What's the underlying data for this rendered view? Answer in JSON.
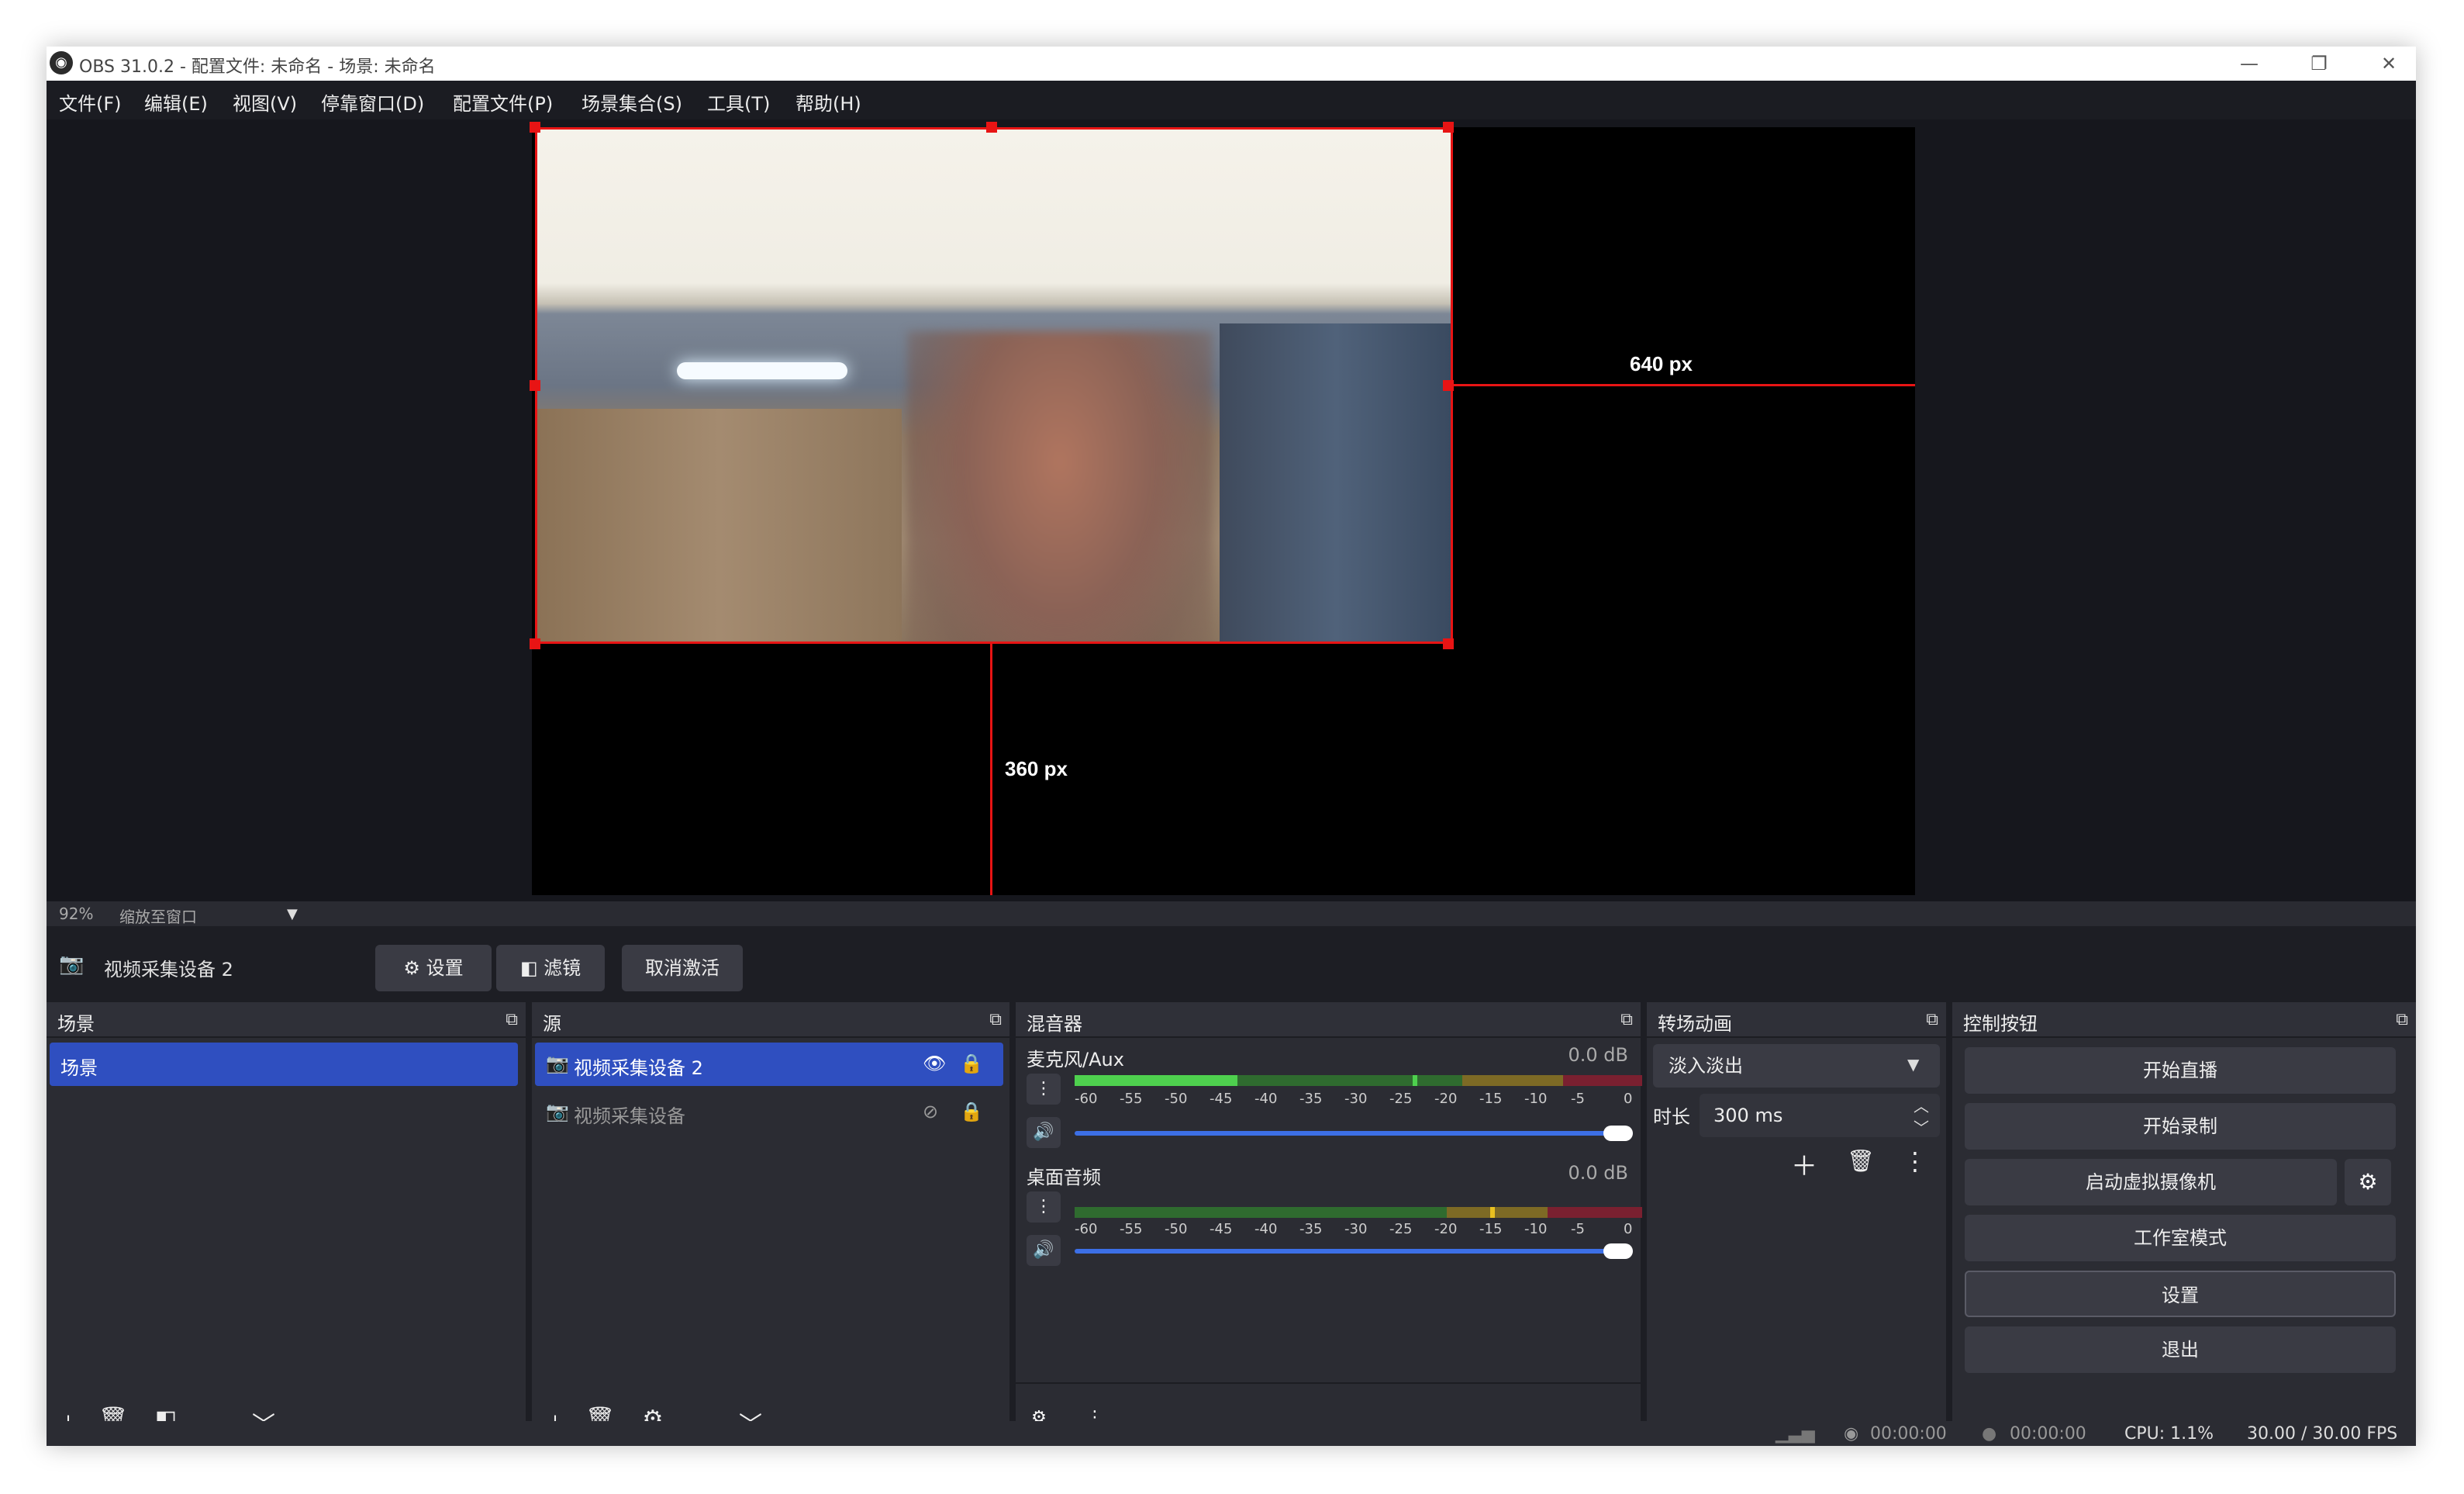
{
  "window": {
    "title": "OBS 31.0.2 - 配置文件: 未命名 - 场景: 未命名",
    "minimize": "—",
    "maximize": "❐",
    "close": "✕"
  },
  "menu": [
    "文件(F)",
    "编辑(E)",
    "视图(V)",
    "停靠窗口(D)",
    "配置文件(P)",
    "场景集合(S)",
    "工具(T)",
    "帮助(H)"
  ],
  "preview": {
    "width_label": "640 px",
    "height_label": "360 px",
    "zoom_value": "92%",
    "zoom_mode": "缩放至窗口",
    "accent": "#e81414"
  },
  "source_toolbar": {
    "source_name": "视频采集设备 2",
    "settings": "设置",
    "filters": "滤镜",
    "deactivate": "取消激活"
  },
  "scenes": {
    "title": "场景",
    "items": [
      "场景"
    ]
  },
  "sources": {
    "title": "源",
    "items": [
      {
        "name": "视频采集设备 2",
        "visible": true,
        "selected": true
      },
      {
        "name": "视频采集设备",
        "visible": false,
        "selected": false
      }
    ]
  },
  "mixer": {
    "title": "混音器",
    "channels": [
      {
        "name": "麦克风/Aux",
        "db": "0.0 dB"
      },
      {
        "name": "桌面音频",
        "db": "0.0 dB"
      }
    ],
    "scale": [
      "-60",
      "-55",
      "-50",
      "-45",
      "-40",
      "-35",
      "-30",
      "-25",
      "-20",
      "-15",
      "-10",
      "-5",
      "0"
    ]
  },
  "transitions": {
    "title": "转场动画",
    "selected": "淡入淡出",
    "duration_label": "时长",
    "duration_value": "300 ms"
  },
  "controls": {
    "title": "控制按钮",
    "start_stream": "开始直播",
    "start_record": "开始录制",
    "virtual_cam": "启动虚拟摄像机",
    "studio_mode": "工作室模式",
    "settings": "设置",
    "exit": "退出"
  },
  "status": {
    "stream_time": "00:00:00",
    "record_time": "00:00:00",
    "cpu": "CPU: 1.1%",
    "fps": "30.00 / 30.00 FPS"
  }
}
